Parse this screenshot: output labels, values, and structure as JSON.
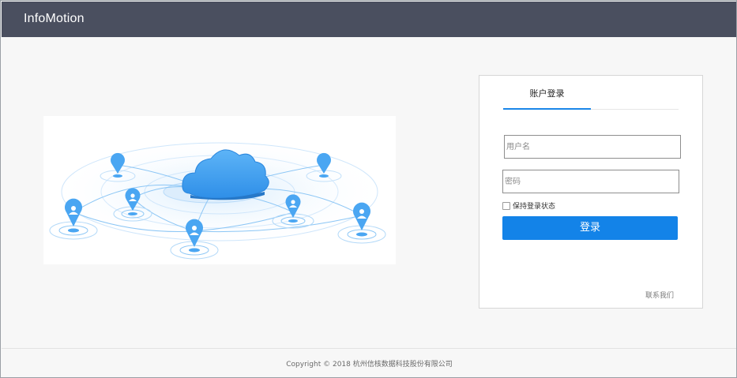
{
  "header": {
    "app_title": "InfoMotion"
  },
  "illustration": {
    "icon": "cloud-network-illustration",
    "colors": {
      "cloud": "#3c9cf0",
      "pin": "#4aa6f2",
      "ring": "#a8d3f7"
    }
  },
  "login": {
    "tab_label": "账户登录",
    "username_placeholder": "用户名",
    "password_placeholder": "密码",
    "remember_label": "保持登录状态",
    "submit_label": "登录",
    "contact_label": "联系我们"
  },
  "footer": {
    "copyright": "Copyright © 2018 杭州信核数据科技股份有限公司"
  },
  "colors": {
    "topbar": "#4a4f5f",
    "accent": "#1383e8"
  }
}
